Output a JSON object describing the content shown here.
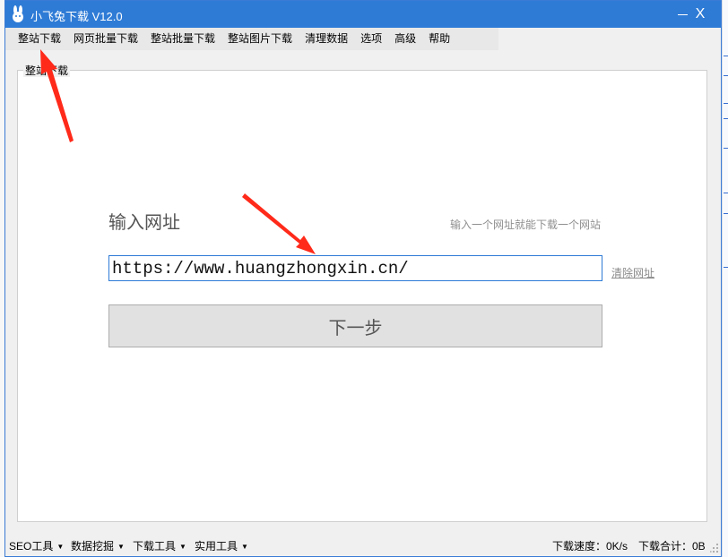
{
  "window": {
    "title": "小飞兔下载 V12.0",
    "close_label": "X",
    "accent_color": "#2e7bd6"
  },
  "menu": {
    "items": [
      {
        "label": "整站下载"
      },
      {
        "label": "网页批量下载"
      },
      {
        "label": "整站批量下载"
      },
      {
        "label": "整站图片下载"
      },
      {
        "label": "清理数据"
      },
      {
        "label": "选项"
      },
      {
        "label": "高级"
      },
      {
        "label": "帮助"
      }
    ]
  },
  "panel": {
    "group_title": "整站下载",
    "input_title": "输入网址",
    "hint": "输入一个网址就能下载一个网站",
    "url_value": "https://www.huangzhongxin.cn/",
    "clear_label": "清除网址",
    "next_label": "下一步"
  },
  "statusbar": {
    "tools": [
      {
        "label": "SEO工具"
      },
      {
        "label": "数据挖掘"
      },
      {
        "label": "下载工具"
      },
      {
        "label": "实用工具"
      }
    ],
    "speed": "下载速度：0K/s",
    "total": "下载合计：0B"
  },
  "annotations": {
    "arrow_color": "#ff2a1a"
  }
}
